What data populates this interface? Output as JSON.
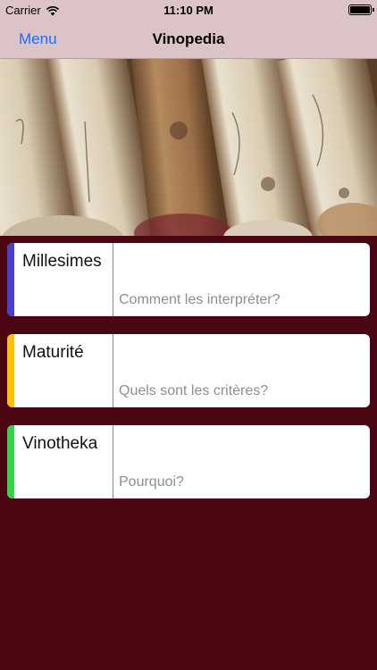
{
  "status_bar": {
    "carrier": "Carrier",
    "time": "11:10 PM",
    "wifi_icon": "wifi-icon",
    "battery_icon": "battery-icon"
  },
  "nav": {
    "menu_label": "Menu",
    "title": "Vinopedia"
  },
  "hero": {
    "image": "wine-corks-photo"
  },
  "colors": {
    "nav_bg": "#dcc4c6",
    "page_bg": "#4a0712",
    "link": "#1a6bff"
  },
  "cards": [
    {
      "title": "Millesimes",
      "subtitle": "Comment les interpréter?",
      "accent": "#4b3fd0"
    },
    {
      "title": "Maturité",
      "subtitle": "Quels sont les critères?",
      "accent": "#ffc107"
    },
    {
      "title": "Vinotheka",
      "subtitle": "Pourquoi?",
      "accent": "#35d14a"
    }
  ]
}
